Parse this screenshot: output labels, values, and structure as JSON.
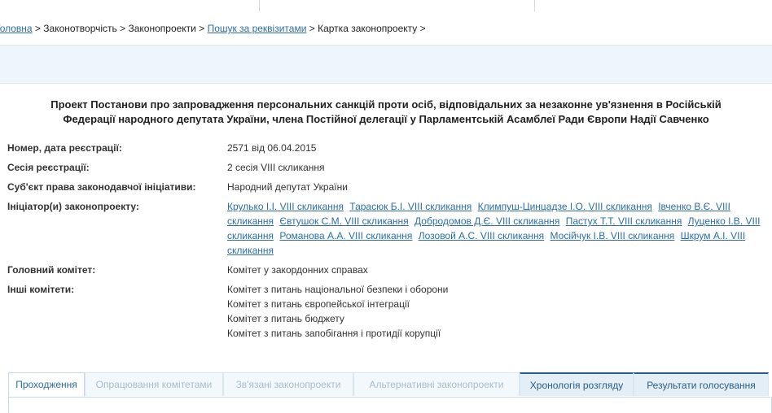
{
  "breadcrumb": {
    "home": "Головна",
    "sep1": " > ",
    "lawmaking": "Законотворчість",
    "sep2": " > ",
    "bills": "Законопроекти",
    "sep3": " > ",
    "search": "Пошук за реквізитами",
    "sep4": " > ",
    "card": "Картка законопроекту",
    "sep5": " >"
  },
  "title": {
    "line1": "Проект Постанови про запровадження персональних санкцій проти осіб, відповідальних за незаконне ув'язнення в Російській",
    "line2": "Федерації народного депутата України, члена Постійної делегації у Парламентській Асамблеї Ради Європи Надії Савченко"
  },
  "fields": {
    "reg_label": "Номер, дата реєстрації:",
    "reg_value": "2571 від 06.04.2015",
    "session_label": "Сесія реєстрації:",
    "session_value": "2 сесія VIII скликання",
    "subject_label": "Суб'єкт права законодавчої ініціативи:",
    "subject_value": "Народний депутат України",
    "initiators_label": "Ініціатор(и) законопроекту:",
    "initiators": [
      "Крулько І.І. VIII скликання",
      "Тарасюк Б.І. VIII скликання",
      "Климпуш-Цинцадзе І.О. VIII скликання",
      "Івченко В.Є. VIII скликання",
      "Євтушок С.М. VIII скликання",
      "Добродомов Д.Є. VIII скликання",
      "Пастух Т.Т. VIII скликання",
      "Луценко І.В. VIII скликання",
      "Романова А.А. VIII скликання",
      "Лозовой А.С. VIII скликання",
      "Мосійчук І.В. VIII скликання",
      "Шкрум А.І. VIII скликання"
    ],
    "main_committee_label": "Головний комітет:",
    "main_committee_value": "Комітет у закордонних справах",
    "other_committees_label": "Інші комітети:",
    "other_committees": [
      "Комітет з питань національної безпеки і оборони",
      "Комітет з питань європейської інтеграції",
      "Комітет з питань бюджету",
      "Комітет з питань запобігання і протидії корупції"
    ]
  },
  "tabs": [
    "Проходження",
    "Опрацювання комітетами",
    "Зв'язані законопроекти",
    "Альтернативні законопроекти",
    "Хронологія розгляду",
    "Результати голосування"
  ],
  "colors": {
    "link": "#2b6ea8",
    "band": "#eef5fb",
    "tab_dark": "#2b5d86"
  }
}
